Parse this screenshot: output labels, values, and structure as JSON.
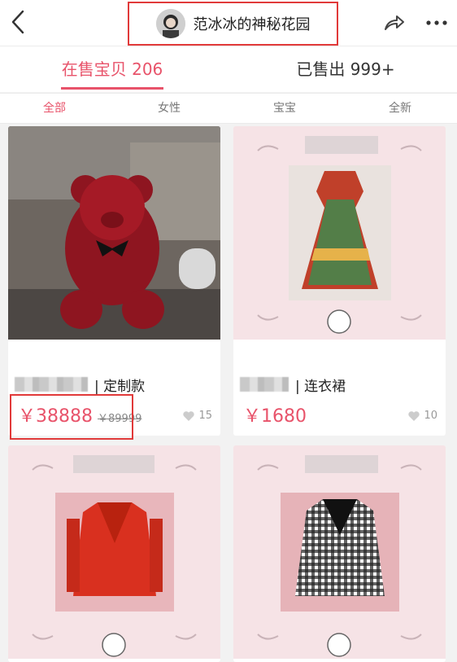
{
  "header": {
    "title": "范冰冰的神秘花园"
  },
  "tabs": [
    {
      "label": "在售宝贝 206",
      "active": true
    },
    {
      "label": "已售出 999+",
      "active": false
    }
  ],
  "filters": [
    {
      "label": "全部",
      "active": true
    },
    {
      "label": "女性",
      "active": false
    },
    {
      "label": "宝宝",
      "active": false
    },
    {
      "label": "全新",
      "active": false
    }
  ],
  "products": [
    {
      "title_suffix": "| 定制款",
      "price": "￥38888",
      "original_price": "￥89999",
      "likes": "15"
    },
    {
      "title_suffix": "| 连衣裙",
      "price": "￥1680",
      "original_price": "",
      "likes": "10"
    },
    {
      "title_suffix": "",
      "price": "",
      "original_price": "",
      "likes": ""
    },
    {
      "title_suffix": "",
      "price": "",
      "original_price": "",
      "likes": ""
    }
  ],
  "colors": {
    "accent": "#e8536a",
    "highlight": "#e13a3a",
    "card_pink": "#f6e3e6"
  },
  "icons": [
    "back-arrow-icon",
    "share-icon",
    "more-icon",
    "heart-icon"
  ]
}
